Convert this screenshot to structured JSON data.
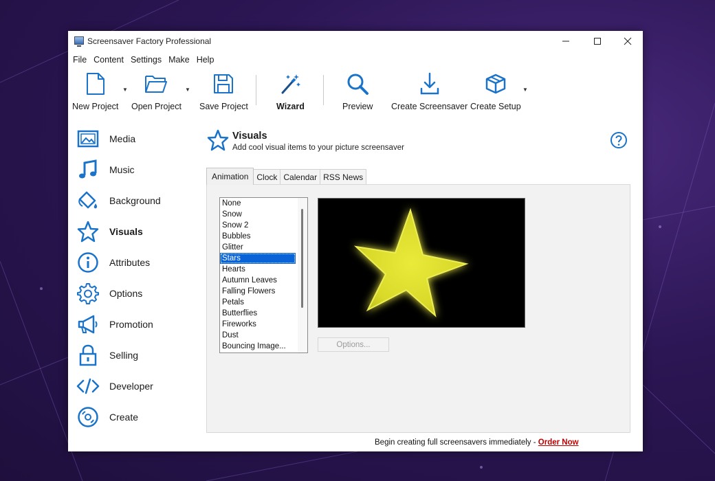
{
  "window": {
    "title": "Screensaver Factory Professional"
  },
  "menu": [
    "File",
    "Content",
    "Settings",
    "Make",
    "Help"
  ],
  "toolbar": {
    "new_project": "New Project",
    "open_project": "Open Project",
    "save_project": "Save Project",
    "wizard": "Wizard",
    "preview": "Preview",
    "create_screensaver": "Create Screensaver",
    "create_setup": "Create Setup"
  },
  "sidebar": {
    "items": [
      {
        "label": "Media",
        "icon": "image-icon"
      },
      {
        "label": "Music",
        "icon": "music-note-icon"
      },
      {
        "label": "Background",
        "icon": "paint-bucket-icon"
      },
      {
        "label": "Visuals",
        "icon": "star-icon",
        "active": true
      },
      {
        "label": "Attributes",
        "icon": "info-icon"
      },
      {
        "label": "Options",
        "icon": "gear-icon"
      },
      {
        "label": "Promotion",
        "icon": "megaphone-icon"
      },
      {
        "label": "Selling",
        "icon": "lock-icon"
      },
      {
        "label": "Developer",
        "icon": "code-icon"
      },
      {
        "label": "Create",
        "icon": "disc-icon"
      }
    ]
  },
  "page": {
    "title": "Visuals",
    "subtitle": "Add cool visual items to your picture screensaver"
  },
  "tabs": [
    "Animation",
    "Clock",
    "Calendar",
    "RSS News"
  ],
  "animation_list": {
    "items": [
      "None",
      "Snow",
      "Snow 2",
      "Bubbles",
      "Glitter",
      "Stars",
      "Hearts",
      "Autumn Leaves",
      "Falling Flowers",
      "Petals",
      "Butterflies",
      "Fireworks",
      "Dust",
      "Bouncing Image..."
    ],
    "selected": "Stars"
  },
  "options_button": "Options...",
  "footer": {
    "text": "Begin creating full screensavers immediately - ",
    "link": "Order Now"
  },
  "colors": {
    "accent": "#1a73c8",
    "selection": "#0a64d8",
    "order_link": "#c00000"
  }
}
